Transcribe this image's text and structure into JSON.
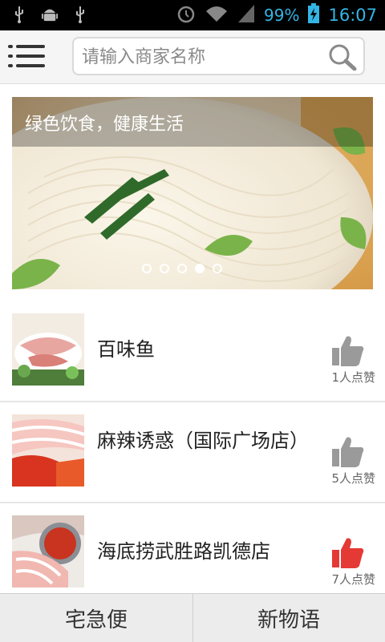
{
  "status_bar": {
    "battery_percent": "99%",
    "time": "16:07",
    "icons": [
      "usb-icon",
      "android-debug-icon",
      "usb-icon",
      "alarm-icon",
      "wifi-icon",
      "signal-icon",
      "battery-charging-icon"
    ]
  },
  "header": {
    "menu_icon": "hamburger-menu-icon",
    "search_placeholder": "请输入商家名称",
    "search_icon": "search-icon"
  },
  "banner": {
    "caption": "绿色饮食，健康生活",
    "dot_count": 5,
    "active_dot": 4
  },
  "restaurants": [
    {
      "name": "百味鱼",
      "likes": "1人点赞",
      "liked": false
    },
    {
      "name": "麻辣诱惑（国际广场店）",
      "likes": "5人点赞",
      "liked": false
    },
    {
      "name": "海底捞武胜路凯德店",
      "likes": "7人点赞",
      "liked": true
    }
  ],
  "colors": {
    "accent_blue": "#33b5e5",
    "like_grey": "#9a9a9a",
    "like_red": "#e53935"
  },
  "bottom_tabs": [
    {
      "label": "宅急便"
    },
    {
      "label": "新物语"
    }
  ]
}
